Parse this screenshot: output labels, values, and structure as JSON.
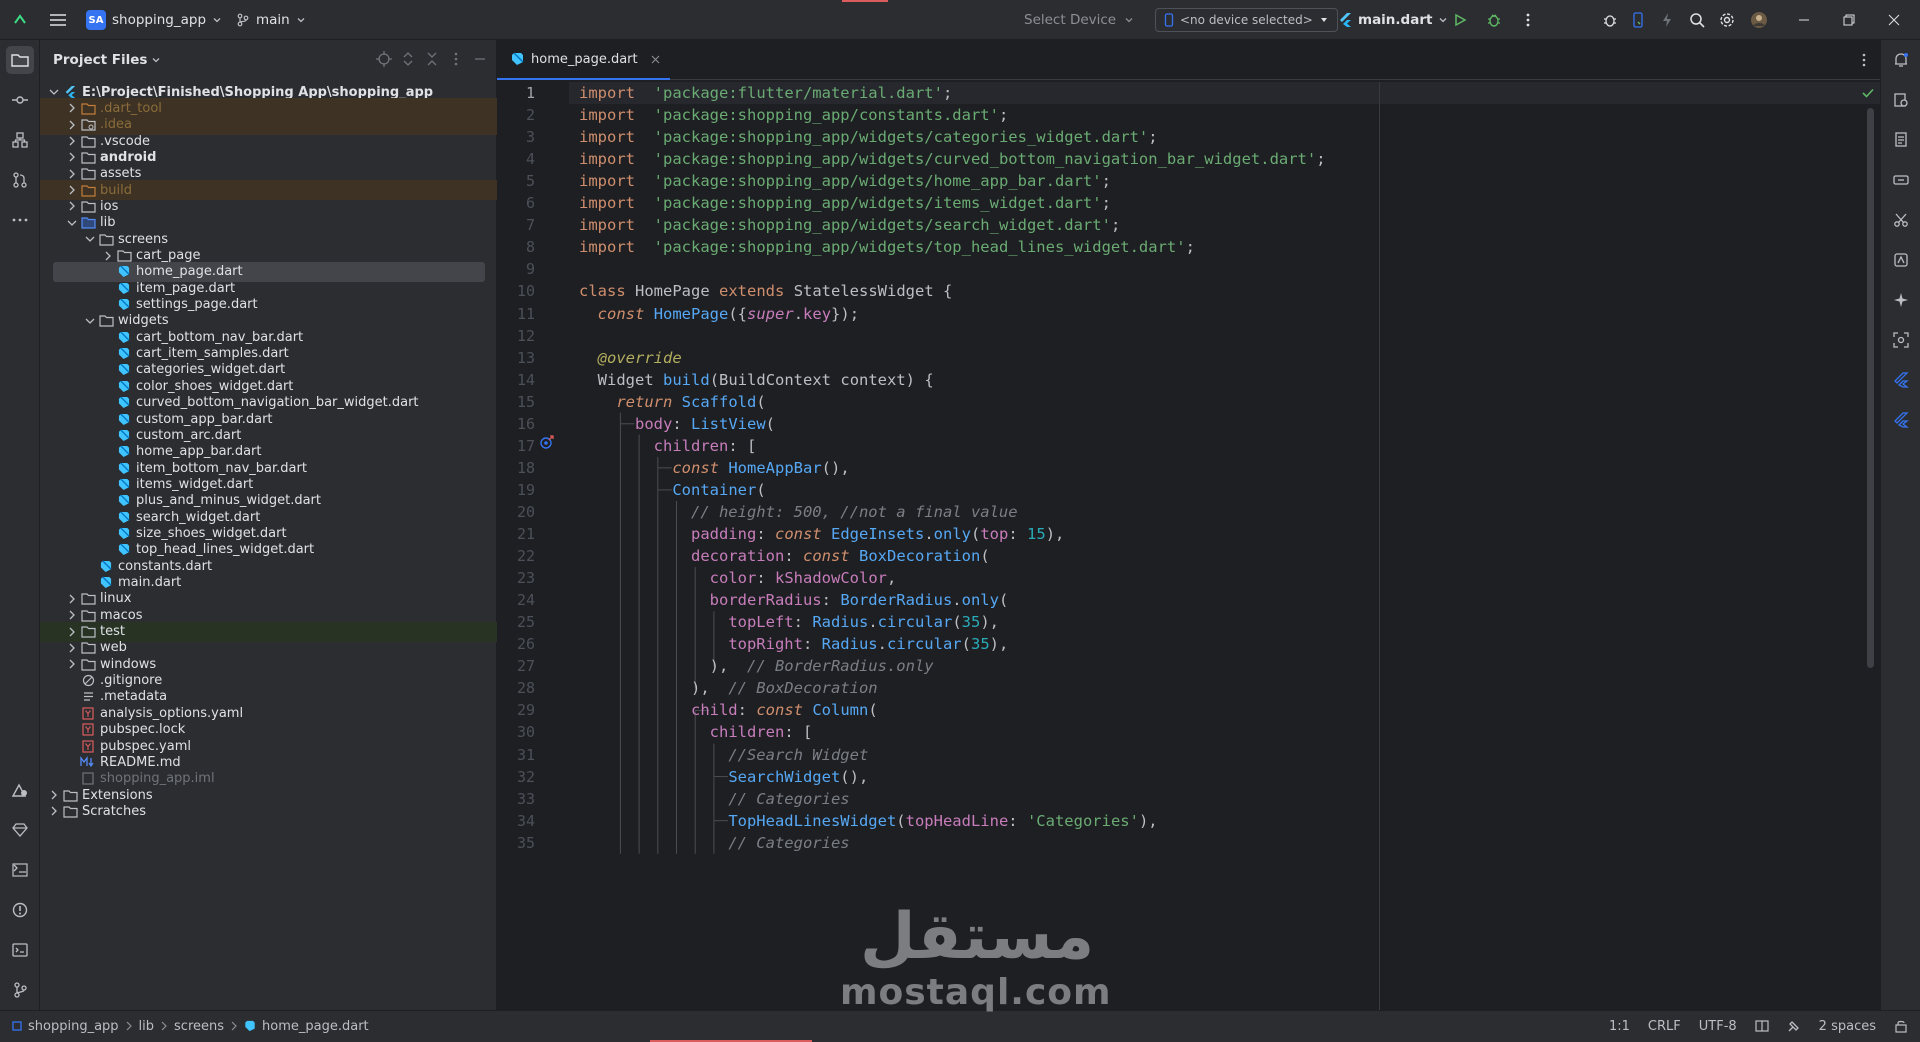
{
  "titlebar": {
    "project_badge": "SA",
    "project_name": "shopping_app",
    "branch": "main",
    "select_device": "Select Device",
    "no_device": "<no device selected>",
    "run_config": "main.dart"
  },
  "project_panel": {
    "title": "Project Files",
    "tree": [
      {
        "label": "E:\\Project\\Finished\\Shopping App\\shopping_app",
        "depth": 0,
        "arrow": "down",
        "icon": "flutter-icon",
        "style": "bold"
      },
      {
        "label": ".dart_tool",
        "depth": 1,
        "arrow": "right",
        "icon": "folder-excluded-icon",
        "style": "excl",
        "bg": "excl"
      },
      {
        "label": ".idea",
        "depth": 1,
        "arrow": "right",
        "icon": "folder-settings-icon",
        "style": "excl",
        "bg": "excl"
      },
      {
        "label": ".vscode",
        "depth": 1,
        "arrow": "right",
        "icon": "folder-icon",
        "style": ""
      },
      {
        "label": "android",
        "depth": 1,
        "arrow": "right",
        "icon": "folder-icon",
        "style": "bold"
      },
      {
        "label": "assets",
        "depth": 1,
        "arrow": "right",
        "icon": "folder-icon",
        "style": ""
      },
      {
        "label": "build",
        "depth": 1,
        "arrow": "right",
        "icon": "folder-excluded-icon",
        "style": "excl",
        "bg": "excl"
      },
      {
        "label": "ios",
        "depth": 1,
        "arrow": "right",
        "icon": "folder-icon",
        "style": ""
      },
      {
        "label": "lib",
        "depth": 1,
        "arrow": "down",
        "icon": "folder-source-icon",
        "style": ""
      },
      {
        "label": "screens",
        "depth": 2,
        "arrow": "down",
        "icon": "folder-icon",
        "style": ""
      },
      {
        "label": "cart_page",
        "depth": 3,
        "arrow": "right",
        "icon": "folder-icon",
        "style": ""
      },
      {
        "label": "home_page.dart",
        "depth": 3,
        "arrow": "",
        "icon": "dart-file-icon",
        "style": "",
        "bg": "sel"
      },
      {
        "label": "item_page.dart",
        "depth": 3,
        "arrow": "",
        "icon": "dart-file-icon",
        "style": ""
      },
      {
        "label": "settings_page.dart",
        "depth": 3,
        "arrow": "",
        "icon": "dart-file-icon",
        "style": ""
      },
      {
        "label": "widgets",
        "depth": 2,
        "arrow": "down",
        "icon": "folder-icon",
        "style": ""
      },
      {
        "label": "cart_bottom_nav_bar.dart",
        "depth": 3,
        "arrow": "",
        "icon": "dart-file-icon",
        "style": ""
      },
      {
        "label": "cart_item_samples.dart",
        "depth": 3,
        "arrow": "",
        "icon": "dart-file-icon",
        "style": ""
      },
      {
        "label": "categories_widget.dart",
        "depth": 3,
        "arrow": "",
        "icon": "dart-file-icon",
        "style": ""
      },
      {
        "label": "color_shoes_widget.dart",
        "depth": 3,
        "arrow": "",
        "icon": "dart-file-icon",
        "style": ""
      },
      {
        "label": "curved_bottom_navigation_bar_widget.dart",
        "depth": 3,
        "arrow": "",
        "icon": "dart-file-icon",
        "style": ""
      },
      {
        "label": "custom_app_bar.dart",
        "depth": 3,
        "arrow": "",
        "icon": "dart-file-icon",
        "style": ""
      },
      {
        "label": "custom_arc.dart",
        "depth": 3,
        "arrow": "",
        "icon": "dart-file-icon",
        "style": ""
      },
      {
        "label": "home_app_bar.dart",
        "depth": 3,
        "arrow": "",
        "icon": "dart-file-icon",
        "style": ""
      },
      {
        "label": "item_bottom_nav_bar.dart",
        "depth": 3,
        "arrow": "",
        "icon": "dart-file-icon",
        "style": ""
      },
      {
        "label": "items_widget.dart",
        "depth": 3,
        "arrow": "",
        "icon": "dart-file-icon",
        "style": ""
      },
      {
        "label": "plus_and_minus_widget.dart",
        "depth": 3,
        "arrow": "",
        "icon": "dart-file-icon",
        "style": ""
      },
      {
        "label": "search_widget.dart",
        "depth": 3,
        "arrow": "",
        "icon": "dart-file-icon",
        "style": ""
      },
      {
        "label": "size_shoes_widget.dart",
        "depth": 3,
        "arrow": "",
        "icon": "dart-file-icon",
        "style": ""
      },
      {
        "label": "top_head_lines_widget.dart",
        "depth": 3,
        "arrow": "",
        "icon": "dart-file-icon",
        "style": ""
      },
      {
        "label": "constants.dart",
        "depth": 2,
        "arrow": "",
        "icon": "dart-file-icon",
        "style": ""
      },
      {
        "label": "main.dart",
        "depth": 2,
        "arrow": "",
        "icon": "dart-file-icon",
        "style": ""
      },
      {
        "label": "linux",
        "depth": 1,
        "arrow": "right",
        "icon": "folder-icon",
        "style": ""
      },
      {
        "label": "macos",
        "depth": 1,
        "arrow": "right",
        "icon": "folder-icon",
        "style": ""
      },
      {
        "label": "test",
        "depth": 1,
        "arrow": "right",
        "icon": "folder-test-icon",
        "style": "",
        "bg": "test"
      },
      {
        "label": "web",
        "depth": 1,
        "arrow": "right",
        "icon": "folder-icon",
        "style": ""
      },
      {
        "label": "windows",
        "depth": 1,
        "arrow": "right",
        "icon": "folder-icon",
        "style": ""
      },
      {
        "label": ".gitignore",
        "depth": 1,
        "arrow": "",
        "icon": "ignore-file-icon",
        "style": ""
      },
      {
        "label": ".metadata",
        "depth": 1,
        "arrow": "",
        "icon": "text-file-icon",
        "style": ""
      },
      {
        "label": "analysis_options.yaml",
        "depth": 1,
        "arrow": "",
        "icon": "yaml-file-icon",
        "style": ""
      },
      {
        "label": "pubspec.lock",
        "depth": 1,
        "arrow": "",
        "icon": "yaml-file-icon",
        "style": ""
      },
      {
        "label": "pubspec.yaml",
        "depth": 1,
        "arrow": "",
        "icon": "yaml-file-icon",
        "style": ""
      },
      {
        "label": "README.md",
        "depth": 1,
        "arrow": "",
        "icon": "markdown-file-icon",
        "style": ""
      },
      {
        "label": "shopping_app.iml",
        "depth": 1,
        "arrow": "",
        "icon": "iml-file-icon",
        "style": "dim"
      },
      {
        "label": "Extensions",
        "depth": 0,
        "arrow": "right",
        "icon": "folder-icon",
        "style": ""
      },
      {
        "label": "Scratches",
        "depth": 0,
        "arrow": "right",
        "icon": "folder-icon",
        "style": ""
      }
    ]
  },
  "editor": {
    "tab": "home_page.dart",
    "current_line": 1,
    "lines": [
      [
        [
          "k",
          "import"
        ],
        [
          "",
          "  "
        ],
        [
          "s",
          "'package:flutter/material.dart'"
        ],
        [
          "",
          ";"
        ]
      ],
      [
        [
          "k",
          "import"
        ],
        [
          "",
          "  "
        ],
        [
          "s",
          "'package:shopping_app/constants.dart'"
        ],
        [
          "",
          ";"
        ]
      ],
      [
        [
          "k",
          "import"
        ],
        [
          "",
          "  "
        ],
        [
          "s",
          "'package:shopping_app/widgets/categories_widget.dart'"
        ],
        [
          "",
          ";"
        ]
      ],
      [
        [
          "k",
          "import"
        ],
        [
          "",
          "  "
        ],
        [
          "s",
          "'package:shopping_app/widgets/curved_bottom_navigation_bar_widget.dart'"
        ],
        [
          "",
          ";"
        ]
      ],
      [
        [
          "k",
          "import"
        ],
        [
          "",
          "  "
        ],
        [
          "s",
          "'package:shopping_app/widgets/home_app_bar.dart'"
        ],
        [
          "",
          ";"
        ]
      ],
      [
        [
          "k",
          "import"
        ],
        [
          "",
          "  "
        ],
        [
          "s",
          "'package:shopping_app/widgets/items_widget.dart'"
        ],
        [
          "",
          ";"
        ]
      ],
      [
        [
          "k",
          "import"
        ],
        [
          "",
          "  "
        ],
        [
          "s",
          "'package:shopping_app/widgets/search_widget.dart'"
        ],
        [
          "",
          ";"
        ]
      ],
      [
        [
          "k",
          "import"
        ],
        [
          "",
          "  "
        ],
        [
          "s",
          "'package:shopping_app/widgets/top_head_lines_widget.dart'"
        ],
        [
          "",
          ";"
        ]
      ],
      [],
      [
        [
          "k",
          "class"
        ],
        [
          "",
          " "
        ],
        [
          "cls",
          "HomePage"
        ],
        [
          "",
          " "
        ],
        [
          "k",
          "extends"
        ],
        [
          "",
          " "
        ],
        [
          "cls",
          "StatelessWidget"
        ],
        [
          "",
          " {"
        ]
      ],
      [
        [
          "",
          "  "
        ],
        [
          "ki",
          "const"
        ],
        [
          "",
          " "
        ],
        [
          "fn",
          "HomePage"
        ],
        [
          "",
          "({"
        ],
        [
          "kc",
          "super"
        ],
        [
          "",
          "."
        ],
        [
          "p",
          "key"
        ],
        [
          "",
          "});"
        ]
      ],
      [],
      [
        [
          "",
          "  "
        ],
        [
          "ann",
          "@override"
        ]
      ],
      [
        [
          "",
          "  "
        ],
        [
          "cls",
          "Widget"
        ],
        [
          "",
          " "
        ],
        [
          "fn",
          "build"
        ],
        [
          "",
          "("
        ],
        [
          "cls",
          "BuildContext"
        ],
        [
          "",
          " "
        ],
        [
          "",
          "context) {"
        ]
      ],
      [
        [
          "",
          "    "
        ],
        [
          "ki",
          "return"
        ],
        [
          "",
          " "
        ],
        [
          "ty",
          "Scaffold"
        ],
        [
          "",
          "("
        ]
      ],
      [
        [
          "",
          "      "
        ],
        [
          "p",
          "body"
        ],
        [
          "",
          ": "
        ],
        [
          "ty",
          "ListView"
        ],
        [
          "",
          "("
        ]
      ],
      [
        [
          "",
          "        "
        ],
        [
          "p",
          "children"
        ],
        [
          "",
          ": ["
        ]
      ],
      [
        [
          "",
          "          "
        ],
        [
          "ki",
          "const"
        ],
        [
          "",
          " "
        ],
        [
          "ty",
          "HomeAppBar"
        ],
        [
          "",
          "(),"
        ]
      ],
      [
        [
          "",
          "          "
        ],
        [
          "ty",
          "Container"
        ],
        [
          "",
          "("
        ]
      ],
      [
        [
          "",
          "            "
        ],
        [
          "c",
          "// height: 500, //not a final value"
        ]
      ],
      [
        [
          "",
          "            "
        ],
        [
          "p",
          "padding"
        ],
        [
          "",
          ": "
        ],
        [
          "ki",
          "const"
        ],
        [
          "",
          " "
        ],
        [
          "ty",
          "EdgeInsets"
        ],
        [
          "",
          "."
        ],
        [
          "fn",
          "only"
        ],
        [
          "",
          "("
        ],
        [
          "p",
          "top"
        ],
        [
          "",
          ": "
        ],
        [
          "n",
          "15"
        ],
        [
          "",
          "),"
        ]
      ],
      [
        [
          "",
          "            "
        ],
        [
          "p",
          "decoration"
        ],
        [
          "",
          ": "
        ],
        [
          "ki",
          "const"
        ],
        [
          "",
          " "
        ],
        [
          "ty",
          "BoxDecoration"
        ],
        [
          "",
          "("
        ]
      ],
      [
        [
          "",
          "              "
        ],
        [
          "p",
          "color"
        ],
        [
          "",
          ": "
        ],
        [
          "t",
          "kShadowColor"
        ],
        [
          "",
          ","
        ]
      ],
      [
        [
          "",
          "              "
        ],
        [
          "p",
          "borderRadius"
        ],
        [
          "",
          ": "
        ],
        [
          "ty",
          "BorderRadius"
        ],
        [
          "",
          "."
        ],
        [
          "fn",
          "only"
        ],
        [
          "",
          "("
        ]
      ],
      [
        [
          "",
          "                "
        ],
        [
          "p",
          "topLeft"
        ],
        [
          "",
          ": "
        ],
        [
          "ty",
          "Radius"
        ],
        [
          "",
          "."
        ],
        [
          "fn",
          "circular"
        ],
        [
          "",
          "("
        ],
        [
          "n",
          "35"
        ],
        [
          "",
          "),"
        ]
      ],
      [
        [
          "",
          "                "
        ],
        [
          "p",
          "topRight"
        ],
        [
          "",
          ": "
        ],
        [
          "ty",
          "Radius"
        ],
        [
          "",
          "."
        ],
        [
          "fn",
          "circular"
        ],
        [
          "",
          "("
        ],
        [
          "n",
          "35"
        ],
        [
          "",
          "),"
        ]
      ],
      [
        [
          "",
          "              "
        ],
        [
          "",
          "),  "
        ],
        [
          "c",
          "// BorderRadius.only"
        ]
      ],
      [
        [
          "",
          "            "
        ],
        [
          "",
          "),  "
        ],
        [
          "c",
          "// BoxDecoration"
        ]
      ],
      [
        [
          "",
          "            "
        ],
        [
          "p",
          "child"
        ],
        [
          "",
          ": "
        ],
        [
          "ki",
          "const"
        ],
        [
          "",
          " "
        ],
        [
          "ty",
          "Column"
        ],
        [
          "",
          "("
        ]
      ],
      [
        [
          "",
          "              "
        ],
        [
          "p",
          "children"
        ],
        [
          "",
          ": ["
        ]
      ],
      [
        [
          "",
          "                "
        ],
        [
          "c",
          "//Search Widget"
        ]
      ],
      [
        [
          "",
          "                "
        ],
        [
          "ty",
          "SearchWidget"
        ],
        [
          "",
          "(),"
        ]
      ],
      [
        [
          "",
          "                "
        ],
        [
          "c",
          "// Categories"
        ]
      ],
      [
        [
          "",
          "                "
        ],
        [
          "ty",
          "TopHeadLinesWidget"
        ],
        [
          "",
          "("
        ],
        [
          "p",
          "topHeadLine"
        ],
        [
          "",
          ": "
        ],
        [
          "s",
          "'Categories'"
        ],
        [
          "",
          "),"
        ]
      ],
      [
        [
          "",
          "                "
        ],
        [
          "c",
          "// Categories"
        ]
      ]
    ]
  },
  "statusbar": {
    "crumbs": [
      "shopping_app",
      "lib",
      "screens",
      "home_page.dart"
    ],
    "position": "1:1",
    "line_sep": "CRLF",
    "encoding": "UTF-8",
    "indent": "2 spaces"
  },
  "watermark": {
    "arabic": "مستقل",
    "latin": "mostaql.com"
  },
  "colors": {
    "accent": "#3574f0",
    "keyword": "#cf8e6d",
    "string": "#6aab73",
    "comment": "#7a7e85",
    "number": "#2aacb8",
    "type": "#56a8f5",
    "property": "#c77dbb",
    "annotation": "#b3ae60"
  }
}
